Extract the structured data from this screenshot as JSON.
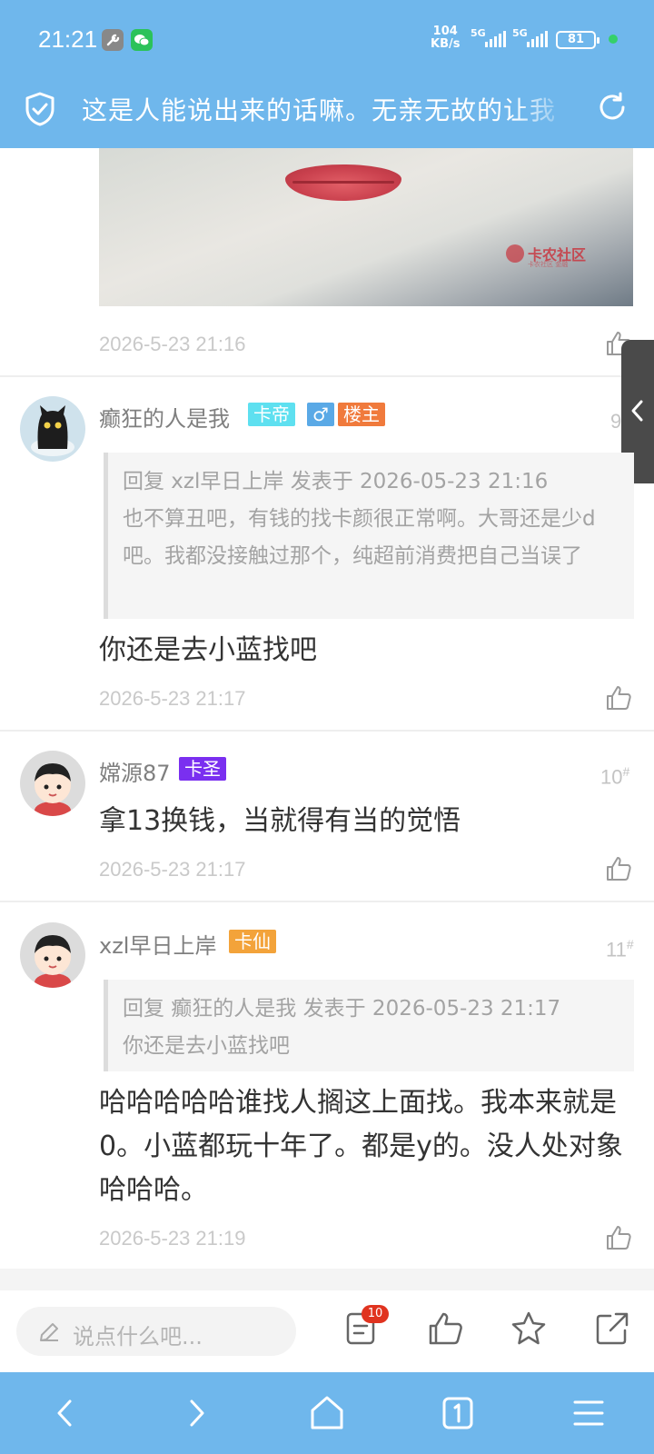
{
  "status": {
    "time": "21:21",
    "speed_value": "104",
    "speed_unit": "KB/s",
    "signal1": "5G",
    "signal2": "5G",
    "battery": "81"
  },
  "header": {
    "title": "这是人能说出来的话嘛。无亲无故的让我"
  },
  "post_photo": {
    "watermark": "卡农社区",
    "watermark_sub": "卡农社区 金融",
    "timestamp": "2026-5-23 21:16"
  },
  "posts": [
    {
      "username": "癫狂的人是我",
      "badge_rank": "卡帝",
      "badge_gender": "♂",
      "badge_op": "楼主",
      "floor_num": "9",
      "quote_header": "回复 xzl早日上岸 发表于 2026-05-23 21:16",
      "quote_text": "也不算丑吧，有钱的找卡颜很正常啊。大哥还是少d吧。我都没接触过那个，纯超前消费把自己当误了",
      "content": "你还是去小蓝找吧",
      "timestamp": "2026-5-23 21:17"
    },
    {
      "username": "嫦源87",
      "badge_rank": "卡圣",
      "floor_num": "10",
      "floor_mark": "#",
      "content": "拿13换钱，当就得有当的觉悟",
      "timestamp": "2026-5-23 21:17"
    },
    {
      "username": "xzl早日上岸",
      "badge_rank": "卡仙",
      "floor_num": "11",
      "floor_mark": "#",
      "quote_header": "回复 癫狂的人是我 发表于 2026-05-23 21:17",
      "quote_text": "你还是去小蓝找吧",
      "content": "哈哈哈哈哈谁找人搁这上面找。我本来就是0。小蓝都玩十年了。都是y的。没人处对象哈哈哈。",
      "timestamp": "2026-5-23 21:19"
    }
  ],
  "bottom": {
    "comment_placeholder": "说点什么吧...",
    "comment_count": "10"
  },
  "colors": {
    "header_blue": "#6fb7ec",
    "badge_cyan": "#5ee0f0",
    "badge_gender": "#5aa9e6",
    "badge_op": "#f07a3c",
    "badge_purple": "#7a2ff0",
    "badge_orange": "#f3a33a"
  }
}
